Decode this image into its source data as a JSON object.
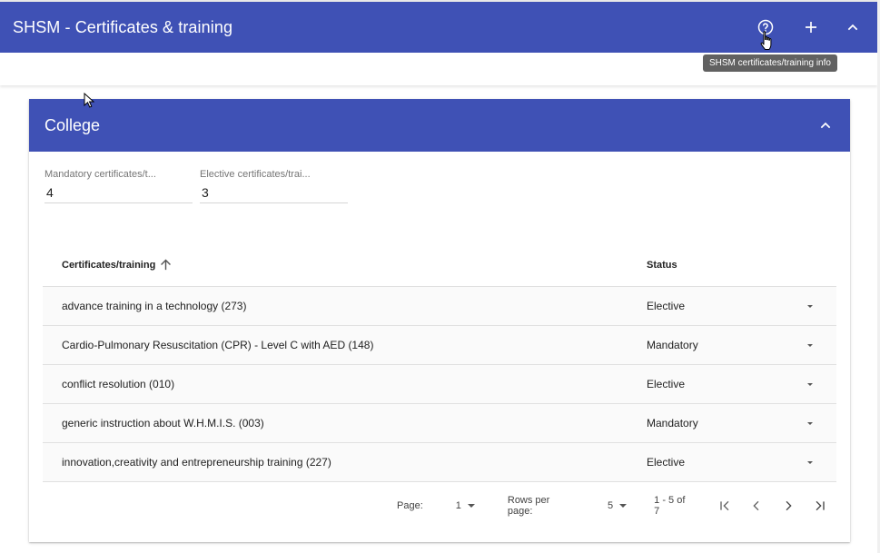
{
  "appbar": {
    "title": "SHSM - Certificates & training",
    "help_tooltip": "SHSM certificates/training info"
  },
  "card": {
    "title": "College",
    "fields": [
      {
        "label": "Mandatory certificates/t...",
        "value": "4"
      },
      {
        "label": "Elective certificates/trai...",
        "value": "3"
      }
    ],
    "table": {
      "columns": {
        "name": "Certificates/training",
        "status": "Status"
      },
      "rows": [
        {
          "name": "advance training in a technology (273)",
          "status": "Elective"
        },
        {
          "name": "Cardio-Pulmonary Resuscitation (CPR) - Level C with AED (148)",
          "status": "Mandatory"
        },
        {
          "name": "conflict resolution (010)",
          "status": "Elective"
        },
        {
          "name": "generic instruction about W.H.M.I.S. (003)",
          "status": "Mandatory"
        },
        {
          "name": "innovation,creativity and entrepreneurship training (227)",
          "status": "Elective"
        }
      ]
    },
    "pagination": {
      "page_label": "Page:",
      "page_value": "1",
      "rows_label": "Rows per page:",
      "rows_value": "5",
      "range": "1 - 5 of 7"
    }
  },
  "colors": {
    "primary": "#3f51b5",
    "tooltip": "#616161"
  },
  "icons": [
    "help-circle-icon",
    "plus-icon",
    "chevron-up-icon",
    "arrow-up-icon",
    "caret-down-icon",
    "first-page-icon",
    "chevron-left-icon",
    "chevron-right-icon",
    "last-page-icon",
    "hand-cursor-icon",
    "arrow-cursor-icon"
  ]
}
